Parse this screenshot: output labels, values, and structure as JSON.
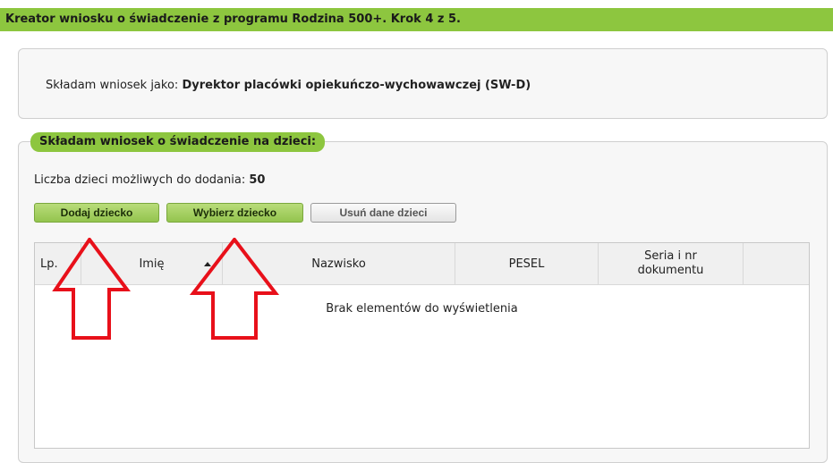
{
  "title": "Kreator wniosku o świadczenie z programu Rodzina 500+. Krok 4 z 5.",
  "role": {
    "prefix": "Składam wniosek jako:",
    "value": "Dyrektor placówki opiekuńczo-wychowawczej (SW-D)"
  },
  "children_section": {
    "legend": "Składam wniosek o świadczenie na dzieci:",
    "count_label": "Liczba dzieci możliwych do dodania:",
    "count_value": "50",
    "buttons": {
      "add": "Dodaj dziecko",
      "select": "Wybierz dziecko",
      "remove": "Usuń dane dzieci"
    },
    "table": {
      "columns": [
        "Lp.",
        "Imię",
        "Nazwisko",
        "PESEL",
        "Seria i nr dokumentu"
      ],
      "sorted_column": "Imię",
      "sort_direction": "ascending",
      "empty_message": "Brak elementów do wyświetlenia"
    }
  },
  "colors": {
    "accent": "#8dc63f",
    "annotation_arrow": "#e8101a"
  }
}
